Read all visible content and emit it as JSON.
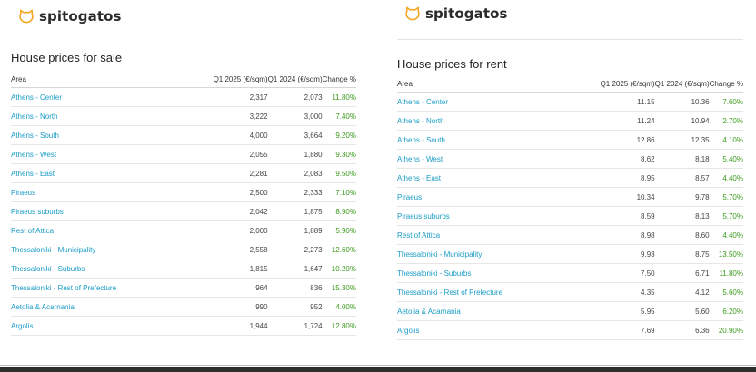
{
  "brand": {
    "name": "spitogatos",
    "accent": "#f5a623"
  },
  "sale": {
    "title": "House prices for sale",
    "headers": [
      "Area",
      "Q1 2025 (€/sqm)",
      "Q1 2024 (€/sqm)",
      "Change %"
    ],
    "rows": [
      [
        "Athens - Center",
        "2,317",
        "2,073",
        "11.80%"
      ],
      [
        "Athens - North",
        "3,222",
        "3,000",
        "7.40%"
      ],
      [
        "Athens - South",
        "4,000",
        "3,664",
        "9.20%"
      ],
      [
        "Athens - West",
        "2,055",
        "1,880",
        "9.30%"
      ],
      [
        "Athens - East",
        "2,281",
        "2,083",
        "9.50%"
      ],
      [
        "Piraeus",
        "2,500",
        "2,333",
        "7.10%"
      ],
      [
        "Piraeus suburbs",
        "2,042",
        "1,875",
        "8.90%"
      ],
      [
        "Rest of Attica",
        "2,000",
        "1,889",
        "5.90%"
      ],
      [
        "Thessaloniki - Municipality",
        "2,558",
        "2,273",
        "12.60%"
      ],
      [
        "Thessaloniki - Suburbs",
        "1,815",
        "1,647",
        "10.20%"
      ],
      [
        "Thessaloniki - Rest of Prefecture",
        "964",
        "836",
        "15.30%"
      ],
      [
        "Aetolia & Acarnania",
        "990",
        "952",
        "4.00%"
      ],
      [
        "Argolis",
        "1,944",
        "1,724",
        "12.80%"
      ]
    ]
  },
  "rent": {
    "title": "House prices for rent",
    "headers": [
      "Area",
      "Q1 2025 (€/sqm)",
      "Q1 2024 (€/sqm)",
      "Change %"
    ],
    "rows": [
      [
        "Athens - Center",
        "11.15",
        "10.36",
        "7.60%"
      ],
      [
        "Athens - North",
        "11.24",
        "10.94",
        "2.70%"
      ],
      [
        "Athens - South",
        "12.86",
        "12.35",
        "4.10%"
      ],
      [
        "Athens - West",
        "8.62",
        "8.18",
        "5.40%"
      ],
      [
        "Athens - East",
        "8.95",
        "8.57",
        "4.40%"
      ],
      [
        "Piraeus",
        "10.34",
        "9.78",
        "5.70%"
      ],
      [
        "Piraeus suburbs",
        "8.59",
        "8.13",
        "5.70%"
      ],
      [
        "Rest of Attica",
        "8.98",
        "8.60",
        "4.40%"
      ],
      [
        "Thessaloniki - Municipality",
        "9.93",
        "8.75",
        "13.50%"
      ],
      [
        "Thessaloniki - Suburbs",
        "7.50",
        "6.71",
        "11.80%"
      ],
      [
        "Thessaloniki - Rest of Prefecture",
        "4.35",
        "4.12",
        "5.60%"
      ],
      [
        "Aetolia & Acarnania",
        "5.95",
        "5.60",
        "6.20%"
      ],
      [
        "Argolis",
        "7.69",
        "6.36",
        "20.90%"
      ]
    ]
  }
}
